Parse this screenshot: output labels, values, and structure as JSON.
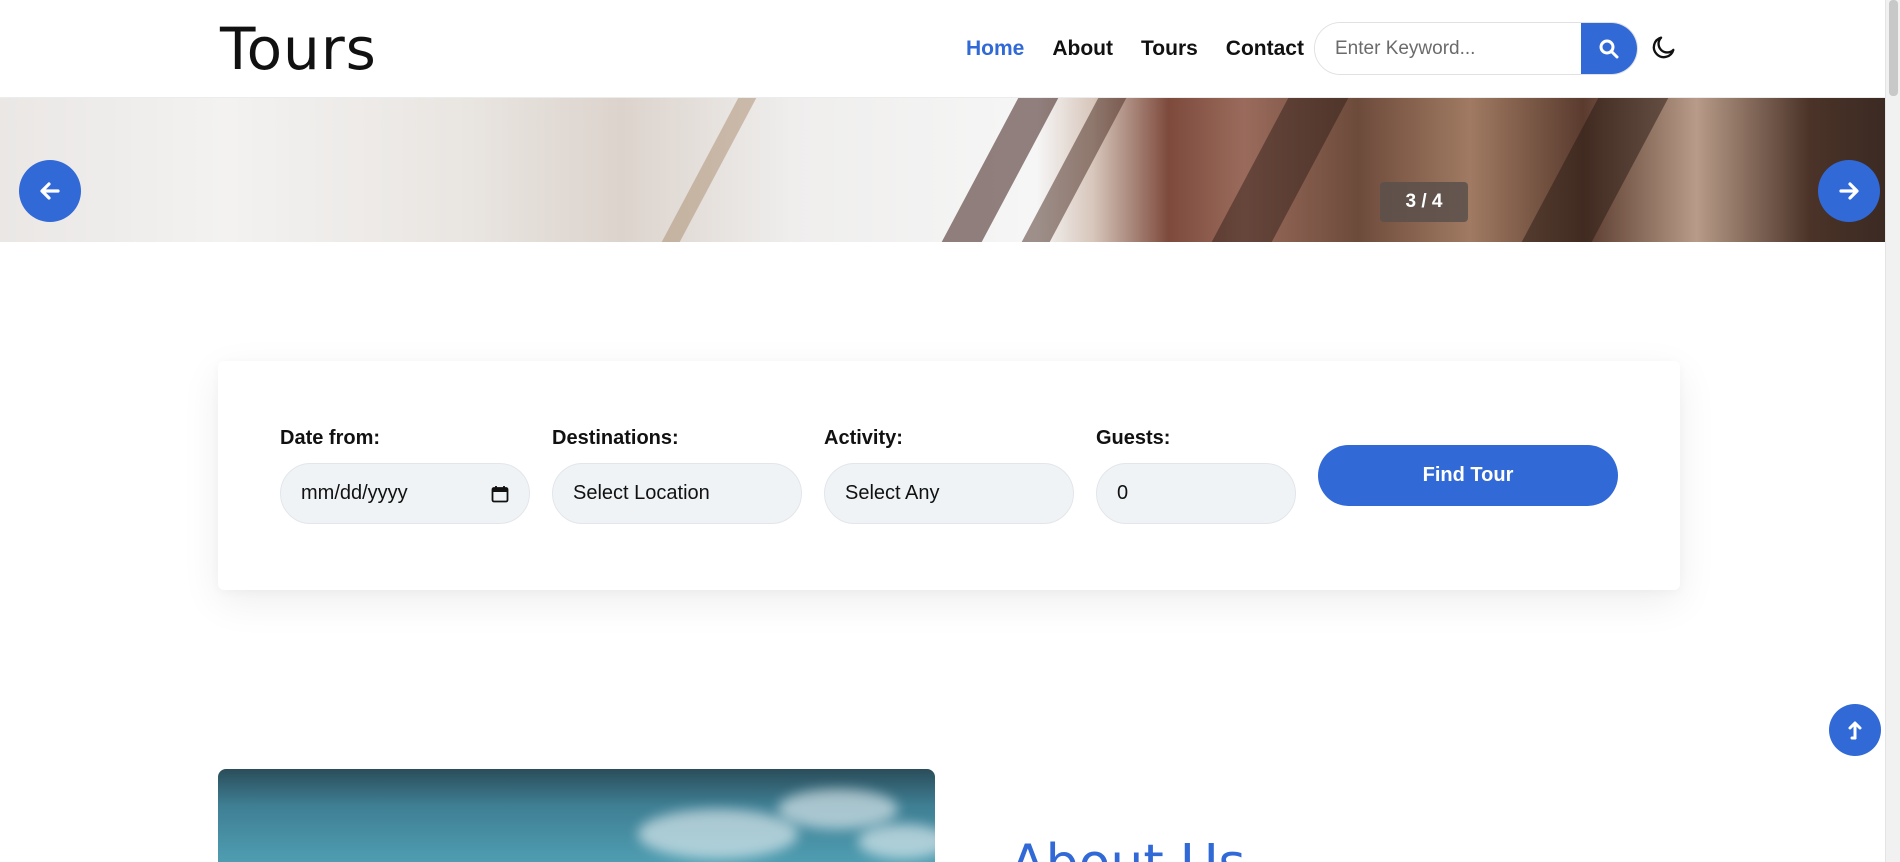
{
  "header": {
    "logo": "Tours",
    "nav": [
      {
        "label": "Home",
        "active": true
      },
      {
        "label": "About",
        "active": false
      },
      {
        "label": "Tours",
        "active": false
      },
      {
        "label": "Contact",
        "active": false
      }
    ],
    "search_placeholder": "Enter Keyword...",
    "search_icon": "search-icon",
    "theme_icon": "moon-icon"
  },
  "hero": {
    "counter": "3 / 4",
    "prev_icon": "arrow-left-icon",
    "next_icon": "arrow-right-icon"
  },
  "search_form": {
    "date_label": "Date from:",
    "date_value": "mm/dd/yyyy",
    "dest_label": "Destinations:",
    "dest_value": "Select Location",
    "activity_label": "Activity:",
    "activity_value": "Select Any",
    "guests_label": "Guests:",
    "guests_value": "0",
    "submit_label": "Find Tour"
  },
  "about": {
    "title": "About Us"
  },
  "colors": {
    "accent": "#3169d6"
  }
}
